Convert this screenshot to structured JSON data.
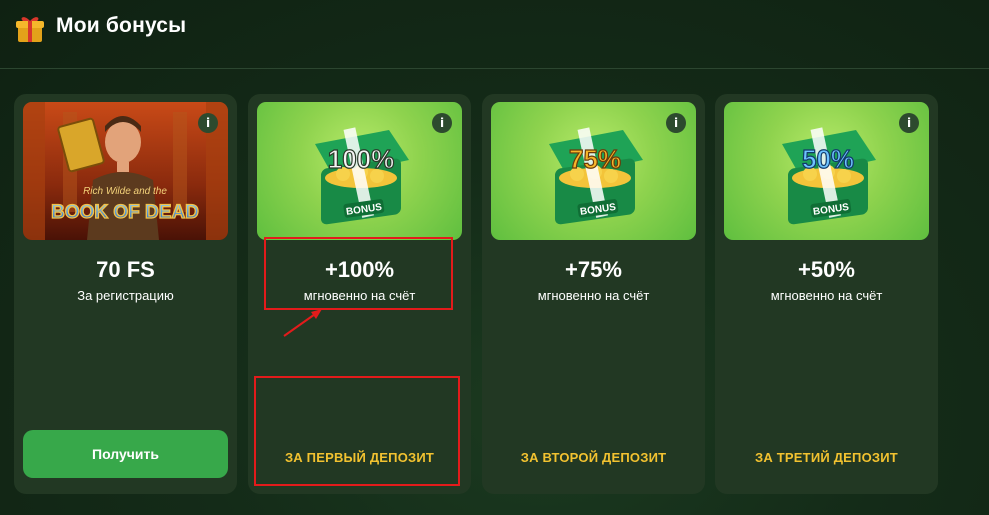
{
  "header": {
    "title": "Мои бонусы",
    "icon": "gift-icon"
  },
  "cards": [
    {
      "title": "70 FS",
      "subtitle": "За регистрацию",
      "button": "Получить",
      "info": "i",
      "image_text_small": "Rich Wilde and the",
      "image_text_big": "BOOK OF DEAD"
    },
    {
      "title": "+100%",
      "subtitle": "мгновенно на счёт",
      "label": "ЗА ПЕРВЫЙ ДЕПОЗИТ",
      "info": "i",
      "chest_percent": "100%",
      "chest_tag": "BONUS",
      "percent_color": "#f5f5f5"
    },
    {
      "title": "+75%",
      "subtitle": "мгновенно на счёт",
      "label": "ЗА ВТОРОЙ ДЕПОЗИТ",
      "info": "i",
      "chest_percent": "75%",
      "chest_tag": "BONUS",
      "percent_color": "#f7b62a"
    },
    {
      "title": "+50%",
      "subtitle": "мгновенно на счёт",
      "label": "ЗА ТРЕТИЙ ДЕПОЗИТ",
      "info": "i",
      "chest_percent": "50%",
      "chest_tag": "BONUS",
      "percent_color": "#6ec3ff"
    }
  ],
  "colors": {
    "accent_green": "#37a84a",
    "deposit_label": "#f2c230",
    "annotation_red": "#e31b1b"
  }
}
